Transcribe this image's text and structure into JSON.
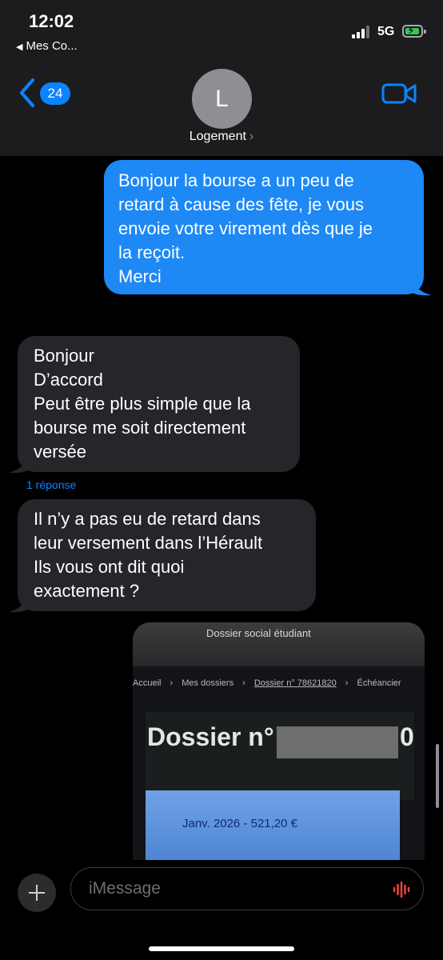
{
  "status": {
    "time": "12:02",
    "back_app": "Mes Co...",
    "network": "5G"
  },
  "nav": {
    "unread_count": "24",
    "avatar_initial": "L",
    "contact_name": "Logement",
    "contact_chevron": "›"
  },
  "messages": {
    "outgoing": [
      "Bonjour la bourse a un peu de",
      "retard à cause des fête, je vous",
      "envoie votre virement dès que je",
      "la reçoit.",
      "Merci"
    ],
    "incoming_1": [
      "Bonjour",
      "D’accord",
      "Peut être plus simple que la",
      "bourse me soit directement",
      "versée"
    ],
    "reply_count": "1 réponse",
    "incoming_2": [
      "Il n’y a pas eu de retard dans",
      "leur versement dans l’Hérault",
      "Ils vous ont dit quoi",
      "exactement ?"
    ]
  },
  "image": {
    "header": "Dossier social étudiant",
    "breadcrumb": [
      "Accueil",
      "›",
      "Mes dossiers",
      "›",
      "Dossier n° 78621820",
      "›",
      "Échéancier"
    ],
    "title": "Dossier n°",
    "title_end": "0",
    "amount": "Janv. 2026 - 521,20 €"
  },
  "composer": {
    "placeholder": "iMessage"
  },
  "colors": {
    "outgoing": "#1e88f5",
    "incoming": "#26252a",
    "accent": "#0a84ff",
    "mic": "#ff453a"
  }
}
